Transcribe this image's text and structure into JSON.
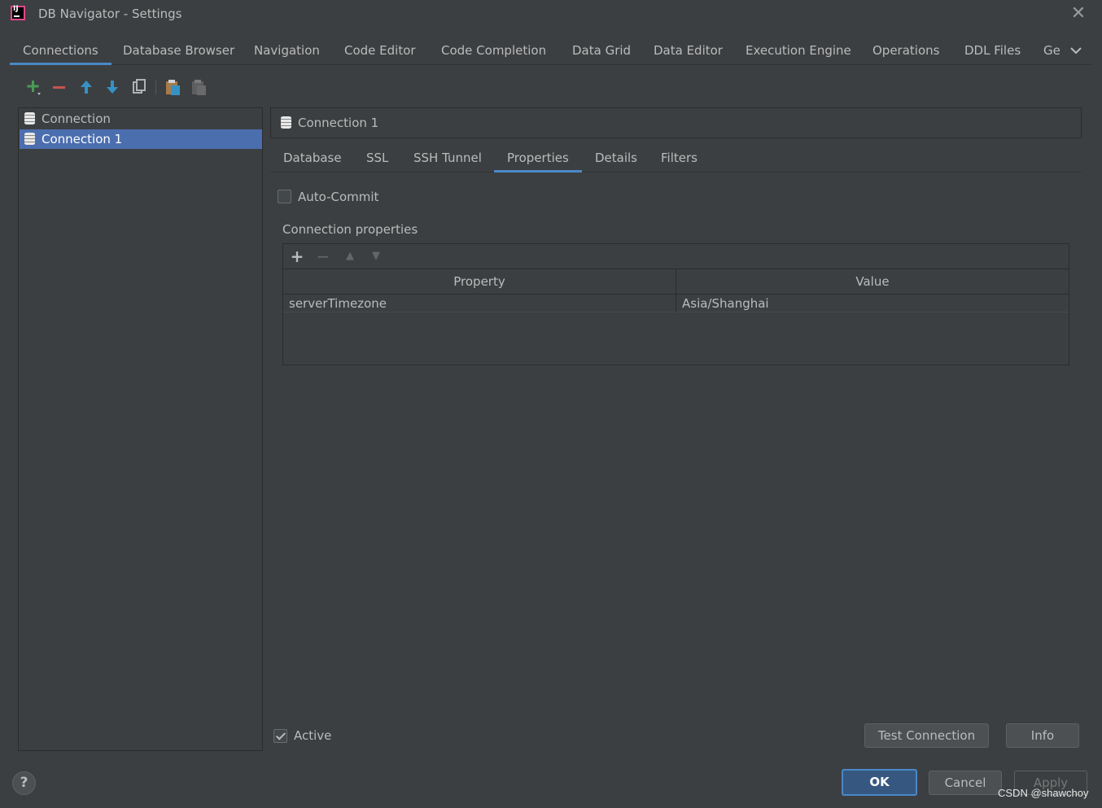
{
  "window": {
    "title": "DB Navigator - Settings",
    "close_glyph": "✕"
  },
  "main_tabs": [
    {
      "label": "Connections",
      "active": true
    },
    {
      "label": "Database Browser"
    },
    {
      "label": "Navigation"
    },
    {
      "label": "Code Editor"
    },
    {
      "label": "Code Completion"
    },
    {
      "label": "Data Grid"
    },
    {
      "label": "Data Editor"
    },
    {
      "label": "Execution Engine"
    },
    {
      "label": "Operations"
    },
    {
      "label": "DDL Files"
    },
    {
      "label": "Ge"
    }
  ],
  "toolbar": {
    "icons": [
      "add-icon",
      "remove-icon",
      "move-up-icon",
      "move-down-icon",
      "copy-icon",
      "paste-icon",
      "paste-disabled-icon"
    ]
  },
  "tree": {
    "items": [
      {
        "label": "Connection",
        "selected": false
      },
      {
        "label": "Connection 1",
        "selected": true
      }
    ]
  },
  "detail": {
    "header_title": "Connection 1",
    "tabs": [
      {
        "label": "Database"
      },
      {
        "label": "SSL"
      },
      {
        "label": "SSH Tunnel"
      },
      {
        "label": "Properties",
        "active": true
      },
      {
        "label": "Details"
      },
      {
        "label": "Filters"
      }
    ],
    "auto_commit_label": "Auto-Commit",
    "auto_commit_checked": false,
    "section_label": "Connection properties",
    "props_toolbar": {
      "add": "+",
      "remove": "−",
      "up": "▲",
      "down": "▼"
    },
    "table": {
      "headers": [
        "Property",
        "Value"
      ],
      "rows": [
        {
          "property": "serverTimezone",
          "value": "Asia/Shanghai"
        }
      ]
    },
    "active_label": "Active",
    "active_checked": true
  },
  "buttons": {
    "test_connection": "Test Connection",
    "info": "Info",
    "ok": "OK",
    "cancel": "Cancel",
    "apply": "Apply",
    "help": "?"
  },
  "watermark": "CSDN @shawchoy",
  "colors": {
    "background": "#3c3f41",
    "accent": "#4a88c7",
    "selection": "#4b6eaf",
    "add_green": "#499c54",
    "remove_red": "#c75450",
    "arrow_blue": "#3592c4"
  }
}
